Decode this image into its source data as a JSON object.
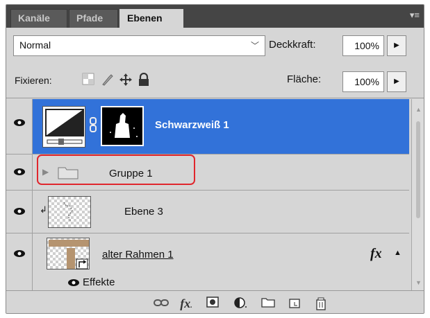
{
  "tabs": [
    "Kanäle",
    "Pfade",
    "Ebenen"
  ],
  "blend": {
    "mode": "Normal",
    "opacity_label": "Deckkraft:",
    "opacity_value": "100%"
  },
  "lock": {
    "label": "Fixieren:",
    "fill_label": "Fläche:",
    "fill_value": "100%"
  },
  "layers": [
    {
      "name": "Schwarzweiß 1",
      "visible": true,
      "selected": true,
      "type": "adjustment"
    },
    {
      "name": "Gruppe 1",
      "visible": true,
      "selected": false,
      "type": "group",
      "highlighted": true
    },
    {
      "name": "Ebene 3",
      "visible": true,
      "selected": false,
      "type": "clipped-layer"
    },
    {
      "name": "alter Rahmen 1",
      "visible": true,
      "selected": false,
      "type": "smart-object",
      "fx": "fx",
      "effects_label": "Effekte"
    }
  ],
  "colors": {
    "selection": "#3272d9",
    "highlight": "#e0262d",
    "tabbar": "#454545",
    "panel": "#d6d6d6"
  },
  "icons": {
    "eye": "eye-icon",
    "link": "link-icon",
    "fx": "fx-icon",
    "mask": "mask-icon",
    "adjustment": "adjustment-icon",
    "folder": "folder-icon",
    "new-layer": "new-layer-icon",
    "trash": "trash-icon"
  }
}
